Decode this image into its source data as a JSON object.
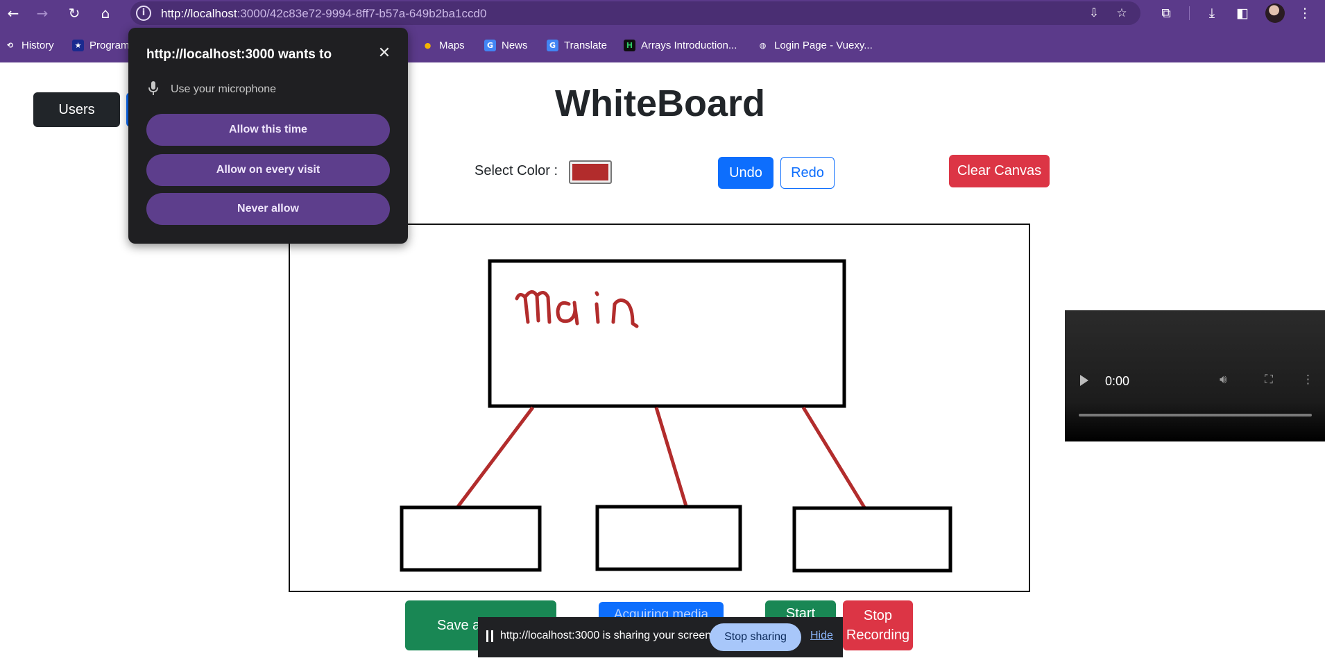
{
  "browser": {
    "url_host": "http://localhost",
    "url_path": ":3000/42c83e72-9994-8ff7-b57a-649b2ba1ccd0",
    "bookmarks": [
      {
        "label": "History",
        "icon": "history-icon"
      },
      {
        "label": "Program",
        "icon": "star-bookmark-icon"
      },
      {
        "label": "Maps",
        "icon": "maps-icon"
      },
      {
        "label": "News",
        "icon": "news-icon"
      },
      {
        "label": "Translate",
        "icon": "translate-icon"
      },
      {
        "label": "Arrays Introduction...",
        "icon": "hackerrank-icon"
      },
      {
        "label": "Login Page - Vuexy...",
        "icon": "globe-icon"
      }
    ]
  },
  "permission_popup": {
    "title": "http://localhost:3000 wants to",
    "request": "Use your microphone",
    "allow_once": "Allow this time",
    "allow_always": "Allow on every visit",
    "never": "Never allow"
  },
  "page": {
    "users_label": "Users",
    "title": "WhiteBoard",
    "select_color_label": "Select Color :",
    "selected_color": "#b22c2c",
    "undo_label": "Undo",
    "redo_label": "Redo",
    "clear_label": "Clear Canvas",
    "canvas_text": "main",
    "save_label": "Save a",
    "blue_label": "Acquiring media",
    "start_label": "Start",
    "stop_label_line1": "Stop",
    "stop_label_line2": "Recording"
  },
  "video": {
    "time": "0:00"
  },
  "share_bar": {
    "message": "http://localhost:3000 is sharing your screen.",
    "stop_label": "Stop sharing",
    "hide_label": "Hide"
  },
  "colors": {
    "browser_bar": "#5b3a8a",
    "primary": "#0d6efd",
    "danger": "#dc3545",
    "success": "#198754",
    "dark": "#212529",
    "drawing": "#b22c2c"
  }
}
